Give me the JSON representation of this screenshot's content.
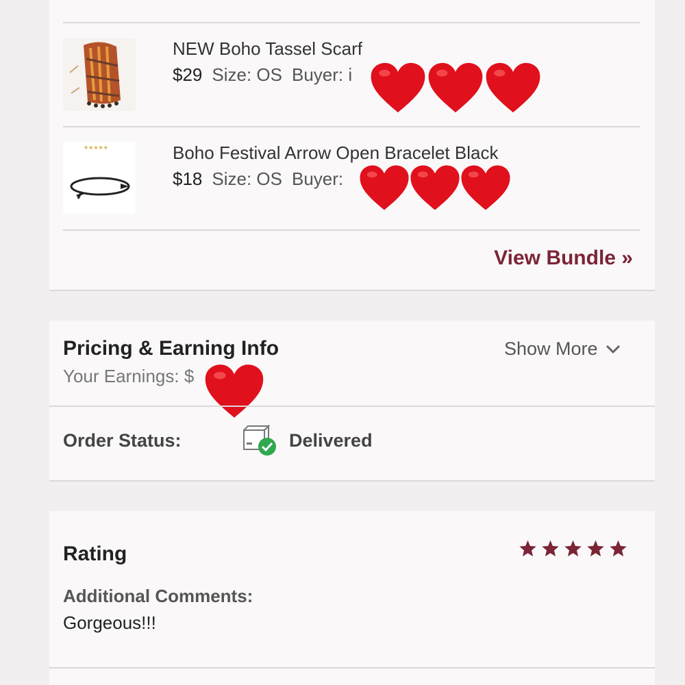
{
  "bundle": {
    "items": [
      {
        "title": "NEW Boho Tassel Scarf",
        "price": "$29",
        "size": "Size: OS",
        "buyer": "Buyer: i"
      },
      {
        "title": "Boho Festival Arrow Open Bracelet Black",
        "price": "$18",
        "size": "Size: OS",
        "buyer": "Buyer:"
      }
    ],
    "view_bundle_label": "View Bundle »"
  },
  "pricing": {
    "title": "Pricing & Earning Info",
    "earnings_label": "Your Earnings: $",
    "show_more_label": "Show More"
  },
  "order": {
    "status_label": "Order Status:",
    "status_value": "Delivered"
  },
  "rating": {
    "title": "Rating",
    "stars": 5,
    "comments_label": "Additional Comments:",
    "comments_text": "Gorgeous!!!"
  },
  "colors": {
    "accent": "#7b2536",
    "heart": "#e0101c",
    "success": "#2fa84f"
  }
}
